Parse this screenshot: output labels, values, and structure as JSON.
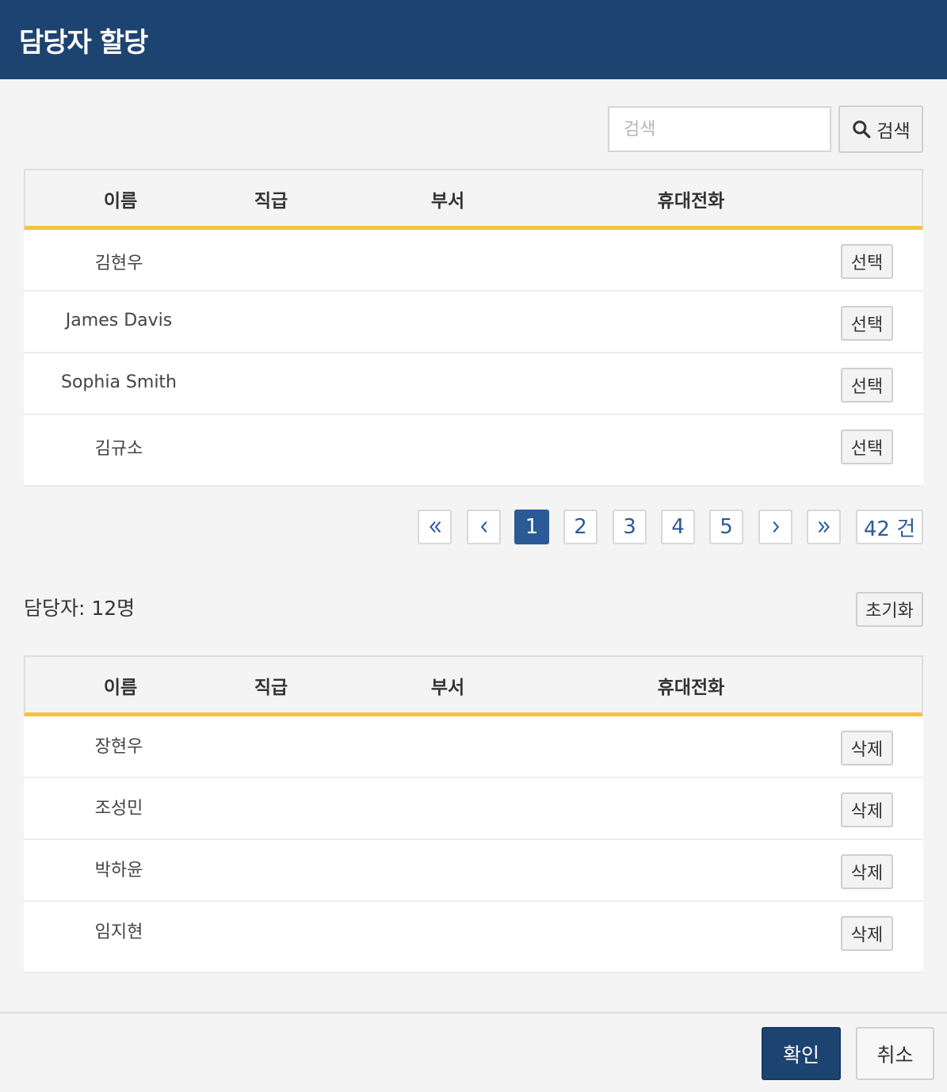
{
  "dialog": {
    "title": "담당자 할당"
  },
  "search": {
    "placeholder": "검색",
    "button_label": "검색"
  },
  "columns": [
    "이름",
    "직급",
    "부서",
    "휴대전화"
  ],
  "candidates": {
    "rows": [
      {
        "name": "김현우",
        "position": "",
        "department": "",
        "mobile": "",
        "action": "선택"
      },
      {
        "name": "James Davis",
        "position": "",
        "department": "",
        "mobile": "",
        "action": "선택"
      },
      {
        "name": "Sophia Smith",
        "position": "",
        "department": "",
        "mobile": "",
        "action": "선택"
      },
      {
        "name": "김규소",
        "position": "",
        "department": "",
        "mobile": "",
        "action": "선택"
      }
    ]
  },
  "pagination": {
    "first": "«",
    "prev": "‹",
    "pages": [
      "1",
      "2",
      "3",
      "4",
      "5"
    ],
    "current": "1",
    "next": "›",
    "last": "»",
    "total": "42 건"
  },
  "assignees": {
    "count_label": "담당자: 12명",
    "reset_label": "초기화",
    "rows": [
      {
        "name": "장현우",
        "position": "",
        "department": "",
        "mobile": "",
        "action": "삭제"
      },
      {
        "name": "조성민",
        "position": "",
        "department": "",
        "mobile": "",
        "action": "삭제"
      },
      {
        "name": "박하윤",
        "position": "",
        "department": "",
        "mobile": "",
        "action": "삭제"
      },
      {
        "name": "임지현",
        "position": "",
        "department": "",
        "mobile": "",
        "action": "삭제"
      }
    ]
  },
  "footer": {
    "confirm_label": "확인",
    "cancel_label": "취소"
  },
  "colors": {
    "header": "#1d4371",
    "accent": "#f3c43b",
    "link": "#2b5a96"
  }
}
